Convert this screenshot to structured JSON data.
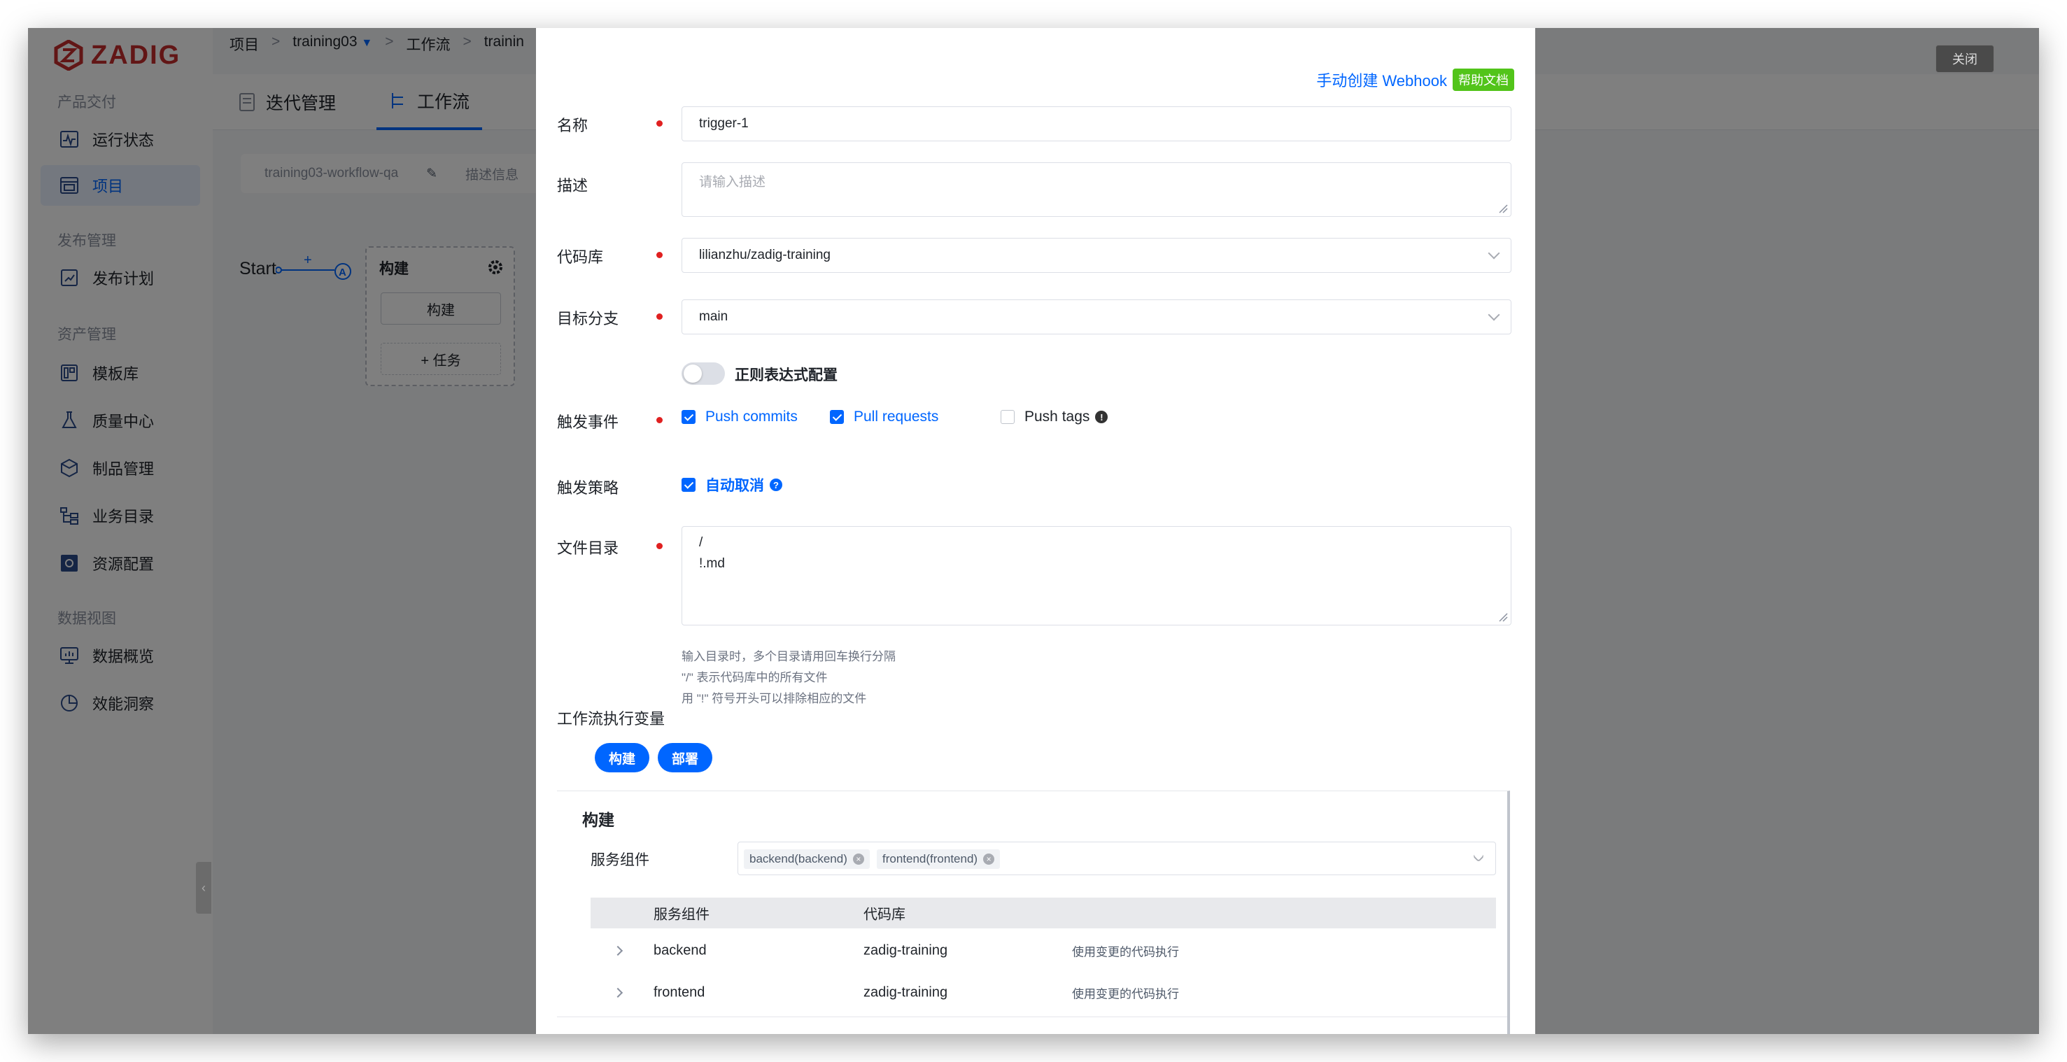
{
  "app": {
    "logo_text": "ZADIG",
    "brand_color": "#c52d2d",
    "accent_color": "#0066ff"
  },
  "sidebar": {
    "groups": [
      "产品交付",
      "发布管理",
      "资产管理",
      "数据视图"
    ],
    "items": [
      {
        "label": "运行状态",
        "icon": "pulse-icon"
      },
      {
        "label": "项目",
        "icon": "project-icon"
      },
      {
        "label": "发布计划",
        "icon": "release-plan-icon"
      },
      {
        "label": "模板库",
        "icon": "template-icon"
      },
      {
        "label": "质量中心",
        "icon": "flask-icon"
      },
      {
        "label": "制品管理",
        "icon": "artifact-icon"
      },
      {
        "label": "业务目录",
        "icon": "catalog-icon"
      },
      {
        "label": "资源配置",
        "icon": "settings-icon"
      },
      {
        "label": "数据概览",
        "icon": "dashboard-icon"
      },
      {
        "label": "效能洞察",
        "icon": "pie-chart-icon"
      }
    ]
  },
  "breadcrumb": {
    "items": [
      "项目",
      "training03",
      "工作流",
      "trainin"
    ],
    "separator": ">"
  },
  "tabs": [
    {
      "label": "迭代管理"
    },
    {
      "label": "工作流"
    }
  ],
  "workflow_bar": {
    "name": "training03-workflow-qa",
    "desc": "描述信息"
  },
  "canvas": {
    "start": "Start",
    "plus": "+",
    "node_letter": "A",
    "stage_title": "构建",
    "stage_job": "构建",
    "add_task": "+ 任务"
  },
  "close_button": "关闭",
  "drawer": {
    "help_link": "手动创建 Webhook",
    "help_badge": "帮助文档",
    "fields": {
      "name": {
        "label": "名称",
        "value": "trigger-1"
      },
      "desc": {
        "label": "描述",
        "placeholder": "请输入描述"
      },
      "repo": {
        "label": "代码库",
        "value": "lilianzhu/zadig-training"
      },
      "branch": {
        "label": "目标分支",
        "value": "main"
      },
      "regex_label": "正则表达式配置",
      "events": {
        "label": "触发事件",
        "options": [
          {
            "label": "Push commits",
            "checked": true
          },
          {
            "label": "Pull requests",
            "checked": true
          },
          {
            "label": "Push tags",
            "checked": false
          }
        ]
      },
      "strategy": {
        "label": "触发策略",
        "option": "自动取消"
      },
      "file_dir": {
        "label": "文件目录",
        "line1": "/",
        "line2": "!.md",
        "hints": [
          "输入目录时，多个目录请用回车换行分隔",
          "\"/\" 表示代码库中的所有文件",
          "用 \"!\" 符号开头可以排除相应的文件"
        ]
      }
    },
    "vars_label": "工作流执行变量",
    "pills": [
      "构建",
      "部署"
    ],
    "build": {
      "title": "构建",
      "service_label": "服务组件",
      "tags": [
        "backend(backend)",
        "frontend(frontend)"
      ],
      "columns": [
        "服务组件",
        "代码库"
      ],
      "rows": [
        {
          "service": "backend",
          "repo": "zadig-training",
          "note": "使用变更的代码执行"
        },
        {
          "service": "frontend",
          "repo": "zadig-training",
          "note": "使用变更的代码执行"
        }
      ]
    }
  }
}
